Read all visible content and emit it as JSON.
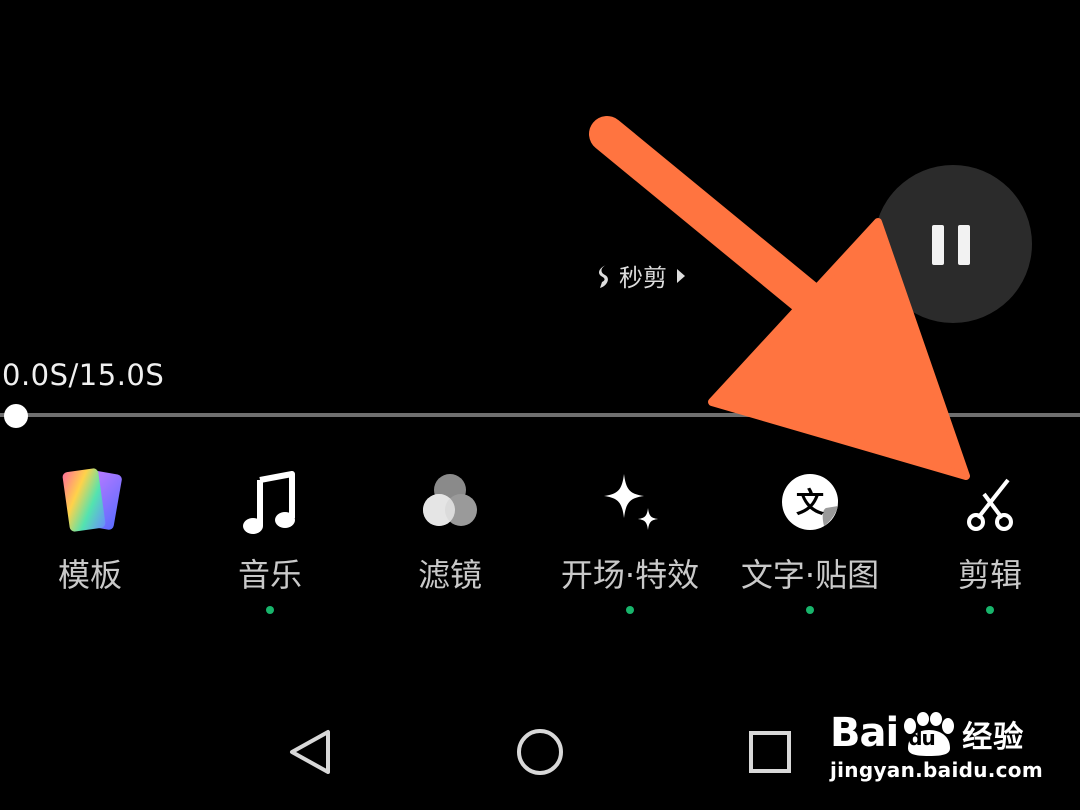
{
  "watermark": {
    "logo": "s-logo-icon",
    "text": "秒剪",
    "garbled": "?????"
  },
  "player": {
    "pause_icon": "pause-icon",
    "time": "0.0S/15.0S",
    "progress": 0.0
  },
  "toolbar": {
    "items": [
      {
        "label": "模板",
        "icon": "template-cards-icon",
        "has_dot": false
      },
      {
        "label": "音乐",
        "icon": "music-note-icon",
        "has_dot": true
      },
      {
        "label": "滤镜",
        "icon": "filter-circles-icon",
        "has_dot": false
      },
      {
        "label": "开场·特效",
        "icon": "sparkle-icon",
        "has_dot": true
      },
      {
        "label": "文字·贴图",
        "icon": "text-sticker-icon",
        "has_dot": true
      },
      {
        "label": "剪辑",
        "icon": "scissors-icon",
        "has_dot": true
      }
    ]
  },
  "annotation": {
    "arrow_color": "#ff7440"
  },
  "navigation": {
    "back_icon": "back-triangle-icon",
    "home_icon": "home-circle-icon",
    "recent_icon": "recent-square-icon"
  },
  "branding": {
    "logo_prefix": "Bai",
    "logo_du": "du",
    "logo_suffix": "经验",
    "url": "jingyan.baidu.com"
  },
  "colors": {
    "background": "#000000",
    "label": "#c9c9c9",
    "dot": "#18b46b",
    "track": "#6f6f6f"
  }
}
